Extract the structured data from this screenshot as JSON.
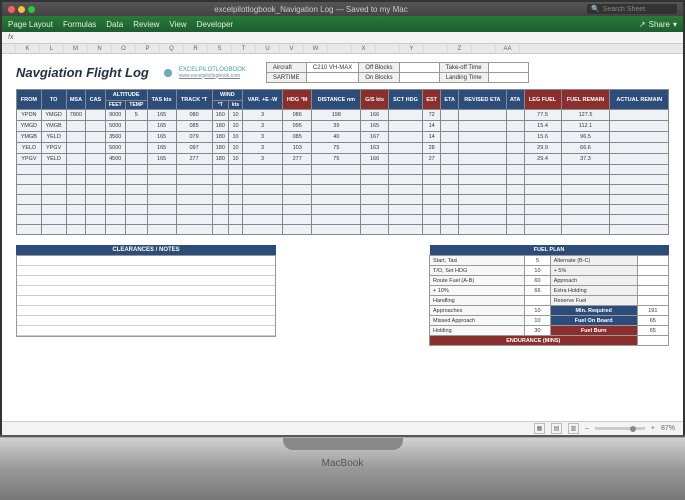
{
  "window": {
    "filename": "excelpilotlogbook_Navigation Log",
    "save_status": "— Saved to my Mac",
    "search_placeholder": "Search Sheet",
    "macbook": "MacBook"
  },
  "ribbon": {
    "tabs": [
      "Page Layout",
      "Formulas",
      "Data",
      "Review",
      "View",
      "Developer"
    ],
    "share": "Share"
  },
  "formula": {
    "fx": "fx"
  },
  "columns": [
    "",
    "K",
    "L",
    "M",
    "N",
    "O",
    "P",
    "Q",
    "R",
    "S",
    "T",
    "U",
    "V",
    "W",
    "",
    "X",
    "",
    "Y",
    "",
    "Z",
    "",
    "AA"
  ],
  "doc": {
    "title": "Navgiation Flight Log",
    "brand": "EXCELPILOTLOGBOOK",
    "brand_url": "www.excelpilotlogbook.com"
  },
  "info": {
    "rows": [
      [
        "Aircraft",
        "C210 VH-MAX",
        "Off Blocks",
        "",
        "Take-off Time",
        ""
      ],
      [
        "SARTIME",
        "",
        "On Blocks",
        "",
        "Landing Time",
        ""
      ]
    ]
  },
  "flight": {
    "headers_top": [
      {
        "t": "FROM",
        "r": 2
      },
      {
        "t": "TO",
        "r": 2
      },
      {
        "t": "MSA",
        "r": 2
      },
      {
        "t": "CAS",
        "r": 2
      },
      {
        "t": "ALTITUDE",
        "c": 2
      },
      {
        "t": "TAS kts",
        "r": 2
      },
      {
        "t": "TRACK °T",
        "r": 2
      },
      {
        "t": "WIND",
        "c": 2
      },
      {
        "t": "VAR. +E -W",
        "r": 2
      },
      {
        "t": "HDG °M",
        "r": 2,
        "red": true
      },
      {
        "t": "DISTANCE nm",
        "r": 2
      },
      {
        "t": "G/S kts",
        "r": 2,
        "red": true
      },
      {
        "t": "SCT HDG",
        "r": 2
      },
      {
        "t": "EST",
        "r": 2,
        "red": true
      },
      {
        "t": "ETA",
        "r": 2
      },
      {
        "t": "REVISED ETA",
        "r": 2
      },
      {
        "t": "ATA",
        "r": 2
      },
      {
        "t": "LEG FUEL",
        "r": 2,
        "red": true
      },
      {
        "t": "FUEL REMAIN",
        "r": 2,
        "red": true
      },
      {
        "t": "ACTUAL REMAIN",
        "r": 2
      }
    ],
    "headers_sub": [
      "FEET",
      "TEMP",
      "°T",
      "kts"
    ],
    "rows": [
      [
        "YPDN",
        "YMGD",
        "7800",
        "",
        "9000",
        "5",
        "165",
        "080",
        "160",
        "10",
        "3",
        "086",
        "198",
        "166",
        "",
        "72",
        "",
        "",
        "",
        "77.5",
        "127.5",
        ""
      ],
      [
        "YMGD",
        "YMGB",
        "",
        "",
        "5000",
        "",
        "165",
        "085",
        "180",
        "10",
        "3",
        "095",
        "39",
        "165",
        "",
        "14",
        "",
        "",
        "",
        "15.4",
        "112.1",
        ""
      ],
      [
        "YMGB",
        "YELD",
        "",
        "",
        "3500",
        "",
        "165",
        "079",
        "180",
        "10",
        "3",
        "085",
        "40",
        "167",
        "",
        "14",
        "",
        "",
        "",
        "15.6",
        "96.5",
        ""
      ],
      [
        "YELD",
        "YPGV",
        "",
        "",
        "5000",
        "",
        "165",
        "097",
        "180",
        "10",
        "3",
        "103",
        "75",
        "163",
        "",
        "28",
        "",
        "",
        "",
        "29.9",
        "66.6",
        ""
      ],
      [
        "YPGV",
        "YELD",
        "",
        "",
        "4500",
        "",
        "165",
        "277",
        "180",
        "10",
        "3",
        "277",
        "75",
        "166",
        "",
        "27",
        "",
        "",
        "",
        "29.4",
        "37.3",
        ""
      ]
    ],
    "empty_rows": 7
  },
  "notes": {
    "title": "CLEARANCES  /  NOTES",
    "lines": 8
  },
  "fuel": {
    "title": "FUEL PLAN",
    "rows": [
      [
        "Start, Taxi",
        "5",
        "Alternate (B-C)",
        ""
      ],
      [
        "T/O, Set HDG",
        "10",
        "+ 5%",
        ""
      ],
      [
        "Route Fuel (A-B)",
        "60",
        "Approach",
        ""
      ],
      [
        "+ 10%",
        "66",
        "Extra Holding",
        ""
      ],
      [
        "Handling",
        "",
        "Reserve Fuel",
        ""
      ],
      [
        "Approaches",
        "10",
        "Min. Required",
        "191"
      ],
      [
        "Missed Approach",
        "10",
        "Fuel On Board",
        "65"
      ],
      [
        "Holding",
        "30",
        "Fuel Burn",
        "65"
      ]
    ],
    "endurance_label": "ENDURANCE (MINS)",
    "endurance_val": ""
  },
  "status": {
    "zoom": "87%",
    "plus": "+",
    "minus": "–"
  }
}
